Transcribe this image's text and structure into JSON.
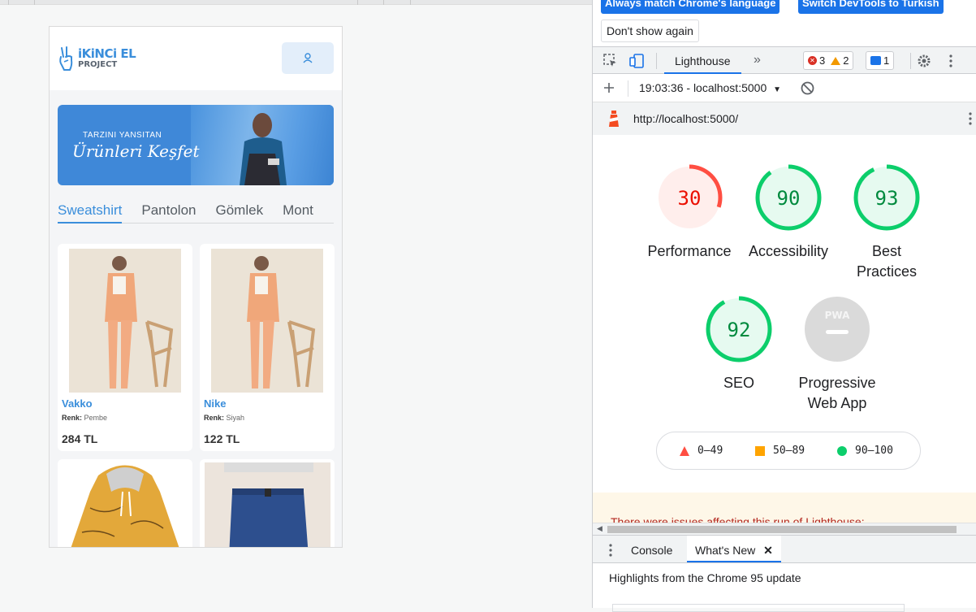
{
  "app": {
    "logo_brand": "iKiNCi EL",
    "logo_sub": "PROJECT",
    "user_button_icon": "user-icon",
    "banner_line1": "TARZINI YANSITAN",
    "banner_line2": "Ürünleri Keşfet",
    "tabs": [
      {
        "label": "Sweatshirt",
        "active": true
      },
      {
        "label": "Pantolon",
        "active": false
      },
      {
        "label": "Gömlek",
        "active": false
      },
      {
        "label": "Mont",
        "active": false
      }
    ],
    "products": [
      {
        "brand": "Vakko",
        "color_label": "Renk:",
        "color_value": "Pembe",
        "price": "284 TL"
      },
      {
        "brand": "Nike",
        "color_label": "Renk:",
        "color_value": "Siyah",
        "price": "122 TL"
      },
      {
        "brand": "",
        "color_label": "",
        "color_value": "",
        "price": ""
      },
      {
        "brand": "",
        "color_label": "",
        "color_value": "",
        "price": ""
      }
    ]
  },
  "devtools": {
    "lang_buttons": [
      "Always match Chrome's language",
      "Switch DevTools to Turkish"
    ],
    "dont_show": "Don't show again",
    "panel_tab": "Lighthouse",
    "errors": "3",
    "warnings": "2",
    "messages": "1",
    "report_time": "19:03:36 - localhost:5000",
    "url": "http://localhost:5000/",
    "scores": [
      {
        "value": "30",
        "score": 30,
        "label": "Performance",
        "status": "fail"
      },
      {
        "value": "90",
        "score": 90,
        "label": "Accessibility",
        "status": "pass"
      },
      {
        "value": "93",
        "score": 93,
        "label": "Best Practices",
        "status": "pass"
      },
      {
        "value": "92",
        "score": 92,
        "label": "SEO",
        "status": "pass"
      },
      {
        "value": "PWA",
        "score": null,
        "label": "Progressive Web App",
        "status": "na"
      }
    ],
    "legend": [
      {
        "range": "0–49",
        "shape": "triangle",
        "color": "#ff4e42"
      },
      {
        "range": "50–89",
        "shape": "square",
        "color": "#ffa400"
      },
      {
        "range": "90–100",
        "shape": "circle",
        "color": "#0cce6b"
      }
    ],
    "warning_text": "There were issues affecting this run of Lighthouse:",
    "drawer_tabs": [
      "Console",
      "What's New"
    ],
    "drawer_headline": "Highlights from the Chrome 95 update"
  },
  "colors": {
    "accent": "#3a8edb",
    "fail": "#ff4e42",
    "pass": "#0cce6b",
    "devtools_blue": "#1a73e8"
  }
}
